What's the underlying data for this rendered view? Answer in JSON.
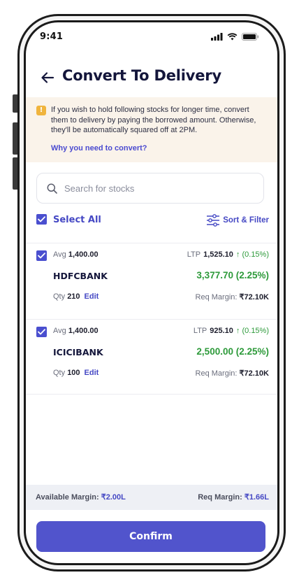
{
  "status_bar": {
    "time": "9:41"
  },
  "header": {
    "title": "Convert To Delivery"
  },
  "banner": {
    "message": "If you wish to hold following stocks for longer time, convert them to delivery by paying the borrowed amount. Otherwise, they'll be automatically squared off at 2PM.",
    "link": "Why you need to convert?"
  },
  "search": {
    "placeholder": "Search for stocks"
  },
  "select_all": {
    "label": "Select All",
    "checked": true
  },
  "sort_filter": {
    "label": "Sort & Filter"
  },
  "stocks": [
    {
      "checked": true,
      "avg_label": "Avg",
      "avg_value": "1,400.00",
      "ltp_label": "LTP",
      "ltp_value": "1,525.10",
      "ltp_change": "↑ (0.15%)",
      "symbol": "HDFCBANK",
      "pnl": "3,377.70 (2.25%)",
      "qty_label": "Qty",
      "qty_value": "210",
      "edit_label": "Edit",
      "req_label": "Req Margin:",
      "req_value": "₹72.10K"
    },
    {
      "checked": true,
      "avg_label": "Avg",
      "avg_value": "1,400.00",
      "ltp_label": "LTP",
      "ltp_value": "925.10",
      "ltp_change": "↑ (0.15%)",
      "symbol": "ICICIBANK",
      "pnl": "2,500.00 (2.25%)",
      "qty_label": "Qty",
      "qty_value": "100",
      "edit_label": "Edit",
      "req_label": "Req Margin:",
      "req_value": "₹72.10K"
    }
  ],
  "footer": {
    "available_label": "Available Margin:",
    "available_value": "₹2.00L",
    "req_label": "Req Margin:",
    "req_value": "₹1.66L",
    "confirm_label": "Confirm"
  },
  "colors": {
    "accent": "#5154cc",
    "positive": "#2d9a3a",
    "banner_bg": "#faf3ea",
    "warning": "#f0b43d"
  }
}
